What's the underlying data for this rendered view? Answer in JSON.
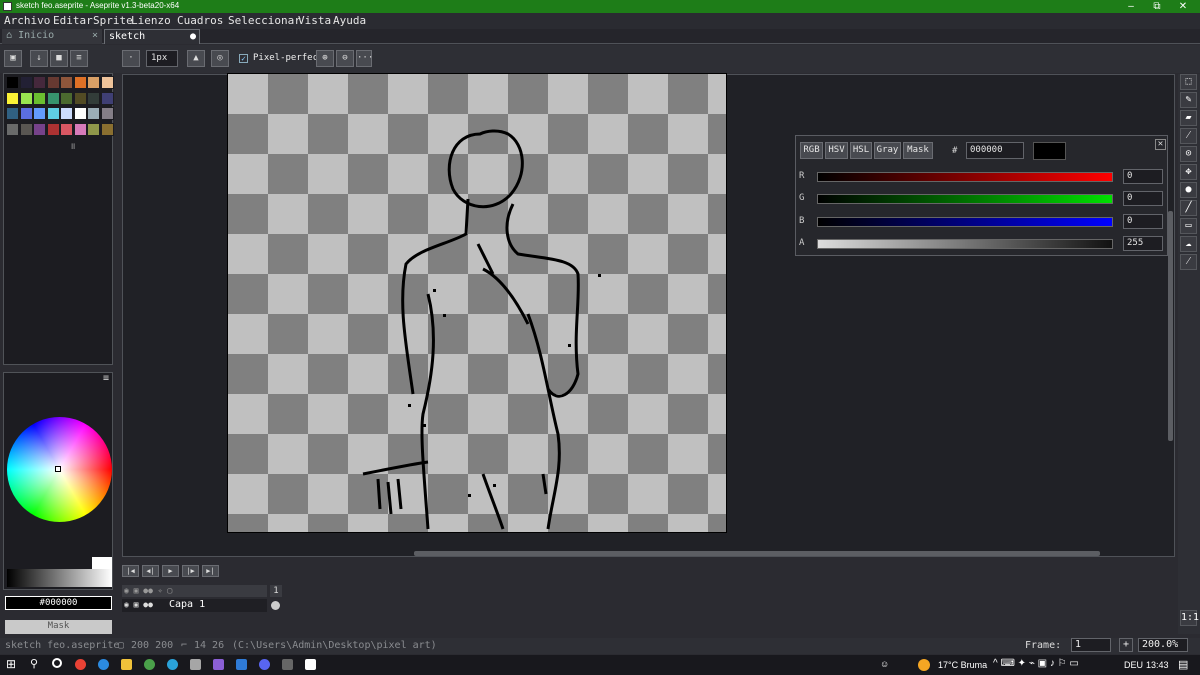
{
  "window": {
    "title": "sketch feo.aseprite - Aseprite v1.3-beta20-x64",
    "minimize": "–",
    "maximize": "⧉",
    "close": "✕"
  },
  "menu": [
    "Archivo",
    "Editar",
    "Sprite",
    "Lienzo",
    "Cuadros",
    "Seleccionar",
    "Vista",
    "Ayuda"
  ],
  "tabs": [
    {
      "label": "Inicio",
      "close": "×"
    },
    {
      "label": "sketch feo.asep",
      "close": "●"
    }
  ],
  "toolbar": {
    "brush_size": "1px",
    "pixel_perfect_label": "Pixel-perfect",
    "more": "···"
  },
  "palette": {
    "colors": [
      "#000000",
      "#222034",
      "#45283c",
      "#663931",
      "#8f563b",
      "#df7126",
      "#d9a066",
      "#eec39a",
      "#fbf236",
      "#99e550",
      "#6abe30",
      "#37946e",
      "#4b692f",
      "#524b24",
      "#323c39",
      "#3f3f74",
      "#306082",
      "#5b6ee1",
      "#639bff",
      "#5fcde4",
      "#cbdbfc",
      "#ffffff",
      "#9badb7",
      "#847e87",
      "#696a6a",
      "#595652",
      "#76428a",
      "#ac3232",
      "#d95763",
      "#d77bba",
      "#8f974a",
      "#8a6f30"
    ],
    "resize_glyph": "॥"
  },
  "color_panel": {
    "menu_icon": "≡",
    "hex_value": "#000000",
    "mask_label": "Mask"
  },
  "color_popup": {
    "tabs": [
      "RGB",
      "HSV",
      "HSL",
      "Gray",
      "Mask"
    ],
    "hash": "#",
    "hex_value": "000000",
    "close": "✕",
    "channels": [
      {
        "label": "R",
        "value": "0"
      },
      {
        "label": "G",
        "value": "0"
      },
      {
        "label": "B",
        "value": "0"
      },
      {
        "label": "A",
        "value": "255"
      }
    ]
  },
  "timeline": {
    "buttons": [
      "|◀",
      "◀|",
      "▶",
      "|▶",
      "▶|"
    ],
    "frame_number": "1",
    "layer_name": "Capa 1"
  },
  "status": {
    "file": "sketch feo.aseprite",
    "size": "200 200",
    "position": "14 26",
    "path": "(C:\\Users\\Admin\\Desktop\\pixel art)",
    "frame_label": "Frame:",
    "frame_value": "1",
    "zoom_plus": "+",
    "zoom": "200.0%",
    "fit_label": "1:1"
  },
  "taskbar": {
    "weather": "17°C  Bruma",
    "lang": "DEU",
    "time": "13:43"
  }
}
